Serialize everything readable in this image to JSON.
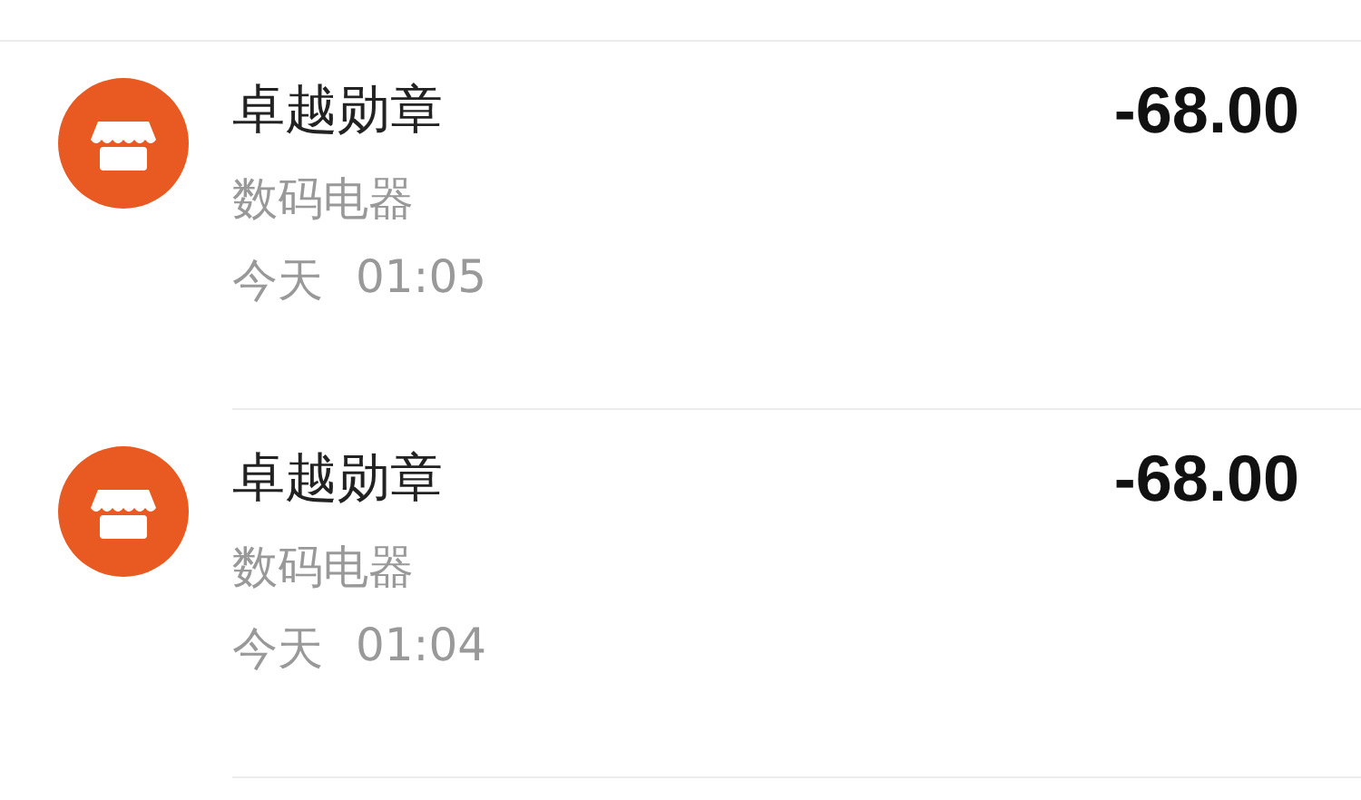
{
  "transactions": [
    {
      "merchant": "卓越勋章",
      "category": "数码电器",
      "day": "今天",
      "time": "01:05",
      "amount": "-68.00",
      "color": "#e85a22"
    },
    {
      "merchant": "卓越勋章",
      "category": "数码电器",
      "day": "今天",
      "time": "01:04",
      "amount": "-68.00",
      "color": "#e85a22"
    }
  ]
}
